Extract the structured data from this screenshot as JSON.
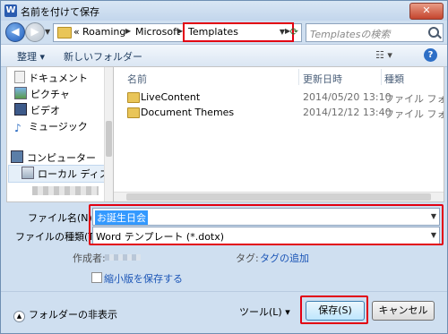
{
  "window": {
    "icon_letter": "W",
    "title": "名前を付けて保存",
    "close_glyph": "✕"
  },
  "nav": {
    "back_glyph": "◀",
    "forward_glyph": "▶",
    "breadcrumb_prefix": "«",
    "breadcrumb": [
      "Roaming",
      "Microsoft",
      "Templates"
    ],
    "search_placeholder": "Templatesの検索",
    "refresh_glyph": "⟳"
  },
  "toolbar": {
    "organize": "整理 ▾",
    "new_folder": "新しいフォルダー",
    "view_glyph": "☷ ▾",
    "help_glyph": "?"
  },
  "sidebar": {
    "items": [
      {
        "label": "ドキュメント",
        "icon": "documents-icon"
      },
      {
        "label": "ピクチャ",
        "icon": "pictures-icon"
      },
      {
        "label": "ビデオ",
        "icon": "videos-icon"
      },
      {
        "label": "ミュージック",
        "icon": "music-icon"
      },
      {
        "label": "コンピューター",
        "icon": "computer-icon"
      },
      {
        "label": "ローカル ディス",
        "icon": "local-disk-icon"
      }
    ]
  },
  "files": {
    "columns": [
      "名前",
      "更新日時",
      "種類"
    ],
    "rows": [
      {
        "name": "LiveContent",
        "date": "2014/05/20 13:10",
        "type": "ファイル フォル"
      },
      {
        "name": "Document Themes",
        "date": "2014/12/12 13:40",
        "type": "ファイル フォル"
      }
    ]
  },
  "form": {
    "filename_label": "ファイル名(N):",
    "filename_value": "お誕生日会",
    "filetype_label": "ファイルの種類(T):",
    "filetype_value": "Word テンプレート (*.dotx)",
    "author_label": "作成者:",
    "tags_label": "タグ:",
    "tags_link": "タグの追加",
    "thumbnail_label": "縮小版を保存する"
  },
  "footer": {
    "hide_folders": "フォルダーの非表示",
    "tools": "ツール(L)   ▾",
    "save": "保存(S)",
    "cancel": "キャンセル"
  },
  "colors": {
    "highlight": "#e20012",
    "selection": "#3399ff",
    "link": "#1b55b6"
  }
}
